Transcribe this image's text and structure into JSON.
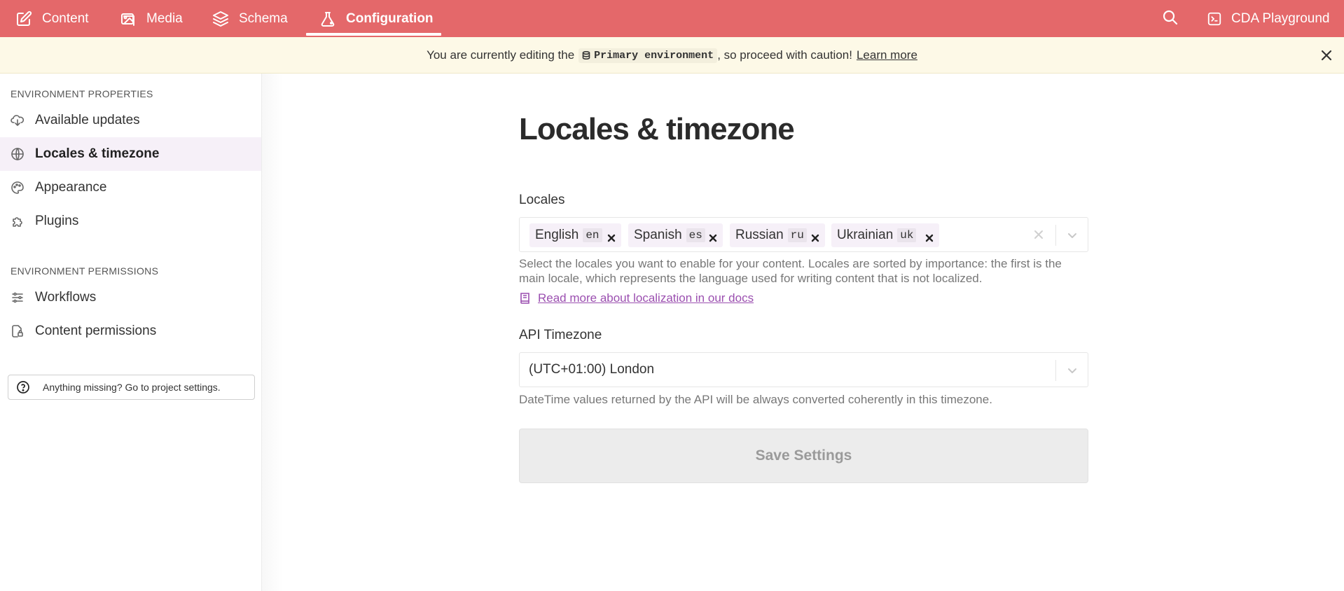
{
  "nav": {
    "items": [
      {
        "label": "Content",
        "icon": "edit-icon"
      },
      {
        "label": "Media",
        "icon": "image-icon"
      },
      {
        "label": "Schema",
        "icon": "layers-icon"
      },
      {
        "label": "Configuration",
        "icon": "flask-icon",
        "active": true
      }
    ],
    "right": {
      "search_icon": "search-icon",
      "playground_label": "CDA Playground",
      "playground_icon": "terminal-icon"
    }
  },
  "banner": {
    "prefix": "You are currently editing the",
    "env_name": "Primary environment",
    "suffix": ", so proceed with caution!",
    "link": "Learn more"
  },
  "sidebar": {
    "section1": "ENVIRONMENT PROPERTIES",
    "items1": [
      {
        "label": "Available updates",
        "icon": "cloud-download-icon"
      },
      {
        "label": "Locales & timezone",
        "icon": "globe-icon",
        "active": true
      },
      {
        "label": "Appearance",
        "icon": "palette-icon"
      },
      {
        "label": "Plugins",
        "icon": "puzzle-icon"
      }
    ],
    "section2": "ENVIRONMENT PERMISSIONS",
    "items2": [
      {
        "label": "Workflows",
        "icon": "workflow-icon"
      },
      {
        "label": "Content permissions",
        "icon": "file-lock-icon"
      }
    ],
    "missing": "Anything missing? Go to project settings."
  },
  "main": {
    "title": "Locales & timezone",
    "locales_label": "Locales",
    "locales": [
      {
        "name": "English",
        "code": "en"
      },
      {
        "name": "Spanish",
        "code": "es"
      },
      {
        "name": "Russian",
        "code": "ru"
      },
      {
        "name": "Ukrainian",
        "code": "uk"
      }
    ],
    "locales_help": "Select the locales you want to enable for your content. Locales are sorted by importance: the first is the main locale, which represents the language used for writing content that is not localized.",
    "docs_link": "Read more about localization in our docs",
    "timezone_label": "API Timezone",
    "timezone_value": "(UTC+01:00) London",
    "timezone_help": "DateTime values returned by the API will be always converted coherently in this timezone.",
    "save_label": "Save Settings"
  },
  "colors": {
    "brand": "#e4686a",
    "banner_bg": "#fdf9e7",
    "link": "#9b4fb0",
    "active_bg": "#f6f0f8"
  }
}
